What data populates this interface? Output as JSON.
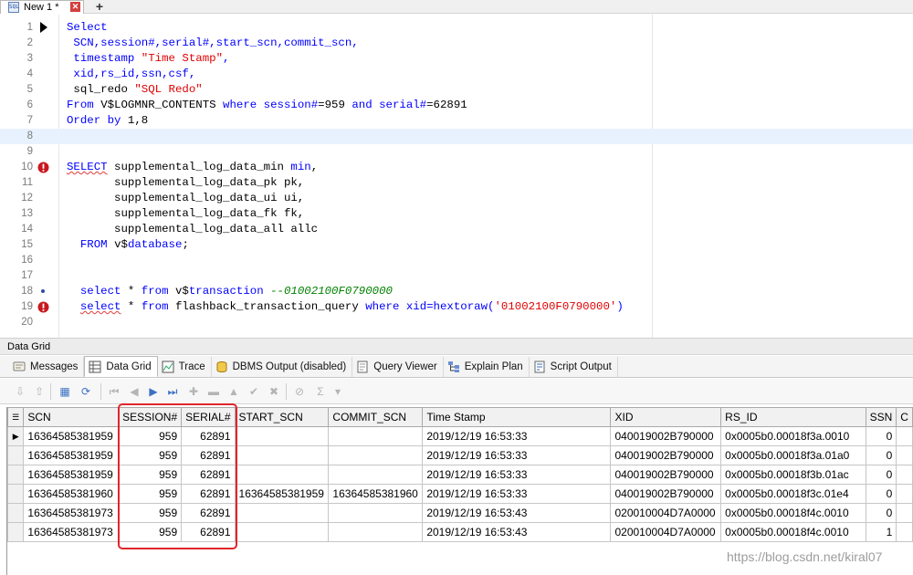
{
  "doc_tab": {
    "icon_text": "SQL",
    "title": "New 1 *",
    "close_label": "✕",
    "new_tab_label": "+"
  },
  "editor": {
    "lines": [
      {
        "n": "1",
        "marker": "current-arrow",
        "parts": [
          {
            "t": "Select",
            "c": "kw"
          }
        ]
      },
      {
        "n": "2",
        "parts": [
          {
            "t": " SCN,session#,serial#,start_scn,commit_scn,",
            "c": "kw"
          }
        ]
      },
      {
        "n": "3",
        "parts": [
          {
            "t": " timestamp ",
            "c": "kw"
          },
          {
            "t": "\"Time Stamp\"",
            "c": "str"
          },
          {
            "t": ",",
            "c": "kw"
          }
        ]
      },
      {
        "n": "4",
        "parts": [
          {
            "t": " xid,rs_id,ssn,csf,",
            "c": "kw"
          }
        ]
      },
      {
        "n": "5",
        "parts": [
          {
            "t": " sql_redo ",
            "c": ""
          },
          {
            "t": "\"SQL Redo\"",
            "c": "str"
          }
        ]
      },
      {
        "n": "6",
        "parts": [
          {
            "t": "From ",
            "c": "kw"
          },
          {
            "t": "V$LOGMNR_CONTENTS ",
            "c": ""
          },
          {
            "t": "where session#",
            "c": "kw"
          },
          {
            "t": "=959 ",
            "c": ""
          },
          {
            "t": "and serial#",
            "c": "kw"
          },
          {
            "t": "=62891",
            "c": ""
          }
        ]
      },
      {
        "n": "7",
        "parts": [
          {
            "t": "Order by ",
            "c": "kw"
          },
          {
            "t": "1,8",
            "c": ""
          }
        ]
      },
      {
        "n": "8",
        "current": true,
        "parts": []
      },
      {
        "n": "9",
        "parts": []
      },
      {
        "n": "10",
        "marker": "error",
        "parts": [
          {
            "t": "SELECT",
            "c": "kw squig"
          },
          {
            "t": " supplemental_log_data_min ",
            "c": ""
          },
          {
            "t": "min",
            "c": "kw"
          },
          {
            "t": ",",
            "c": ""
          }
        ]
      },
      {
        "n": "11",
        "parts": [
          {
            "t": "       supplemental_log_data_pk pk,",
            "c": ""
          }
        ]
      },
      {
        "n": "12",
        "parts": [
          {
            "t": "       supplemental_log_data_ui ui,",
            "c": ""
          }
        ]
      },
      {
        "n": "13",
        "parts": [
          {
            "t": "       supplemental_log_data_fk fk,",
            "c": ""
          }
        ]
      },
      {
        "n": "14",
        "parts": [
          {
            "t": "       supplemental_log_data_all allc",
            "c": ""
          }
        ]
      },
      {
        "n": "15",
        "parts": [
          {
            "t": "  FROM ",
            "c": "kw"
          },
          {
            "t": "v$",
            "c": ""
          },
          {
            "t": "database",
            "c": "kw"
          },
          {
            "t": ";",
            "c": ""
          }
        ]
      },
      {
        "n": "16",
        "parts": []
      },
      {
        "n": "17",
        "parts": []
      },
      {
        "n": "18",
        "marker": "bookmark",
        "parts": [
          {
            "t": "  select ",
            "c": "kw"
          },
          {
            "t": "* ",
            "c": ""
          },
          {
            "t": "from ",
            "c": "kw"
          },
          {
            "t": "v$",
            "c": ""
          },
          {
            "t": "transaction ",
            "c": "kw"
          },
          {
            "t": "--01002100F0790000",
            "c": "cmt"
          }
        ]
      },
      {
        "n": "19",
        "marker": "error",
        "parts": [
          {
            "t": "  ",
            "c": ""
          },
          {
            "t": "select",
            "c": "kw squig"
          },
          {
            "t": " * ",
            "c": ""
          },
          {
            "t": "from ",
            "c": "kw"
          },
          {
            "t": "flashback_transaction_query ",
            "c": ""
          },
          {
            "t": "where xid=hextoraw(",
            "c": "kw"
          },
          {
            "t": "'01002100F0790000'",
            "c": "str"
          },
          {
            "t": ")",
            "c": "kw"
          }
        ]
      },
      {
        "n": "20",
        "parts": []
      }
    ]
  },
  "panel": {
    "title": "Data Grid",
    "tabs": [
      {
        "label": "Messages",
        "icon": "messages-icon",
        "active": false
      },
      {
        "label": "Data Grid",
        "icon": "data-grid-icon",
        "active": true
      },
      {
        "label": "Trace",
        "icon": "trace-icon",
        "active": false
      },
      {
        "label": "DBMS Output (disabled)",
        "icon": "dbms-output-icon",
        "active": false
      },
      {
        "label": "Query Viewer",
        "icon": "query-viewer-icon",
        "active": false
      },
      {
        "label": "Explain Plan",
        "icon": "explain-plan-icon",
        "active": false
      },
      {
        "label": "Script Output",
        "icon": "script-output-icon",
        "active": false
      }
    ]
  },
  "toolbar": {
    "buttons": [
      {
        "name": "export-icon",
        "glyph": "⇩",
        "enabled": false
      },
      {
        "name": "import-icon",
        "glyph": "⇧",
        "enabled": false
      },
      {
        "name": "grid-settings-icon",
        "glyph": "▦",
        "enabled": true
      },
      {
        "name": "refresh-icon",
        "glyph": "⟳",
        "enabled": true
      },
      {
        "name": "first-record-icon",
        "glyph": "⏮",
        "enabled": false
      },
      {
        "name": "prior-record-icon",
        "glyph": "◀",
        "enabled": false
      },
      {
        "name": "next-record-icon",
        "glyph": "▶",
        "enabled": true
      },
      {
        "name": "last-record-icon",
        "glyph": "⏭",
        "enabled": true
      },
      {
        "name": "insert-record-icon",
        "glyph": "✚",
        "enabled": false
      },
      {
        "name": "delete-record-icon",
        "glyph": "▬",
        "enabled": false
      },
      {
        "name": "edit-record-icon",
        "glyph": "▲",
        "enabled": false
      },
      {
        "name": "post-edit-icon",
        "glyph": "✔",
        "enabled": false
      },
      {
        "name": "cancel-edit-icon",
        "glyph": "✖",
        "enabled": false
      },
      {
        "name": "filter-icon",
        "glyph": "⊘",
        "enabled": false
      },
      {
        "name": "sum-icon",
        "glyph": "Σ",
        "enabled": false
      },
      {
        "name": "sum-dropdown-icon",
        "glyph": "▾",
        "enabled": false
      }
    ]
  },
  "grid": {
    "columns": [
      "SCN",
      "SESSION#",
      "SERIAL#",
      "START_SCN",
      "COMMIT_SCN",
      "Time Stamp",
      "XID",
      "RS_ID",
      "SSN",
      "C"
    ],
    "rows": [
      [
        "16364585381959",
        "959",
        "62891",
        "",
        "",
        "2019/12/19 16:53:33",
        "040019002B790000",
        "0x0005b0.00018f3a.0010",
        "0",
        ""
      ],
      [
        "16364585381959",
        "959",
        "62891",
        "",
        "",
        "2019/12/19 16:53:33",
        "040019002B790000",
        "0x0005b0.00018f3a.01a0",
        "0",
        ""
      ],
      [
        "16364585381959",
        "959",
        "62891",
        "",
        "",
        "2019/12/19 16:53:33",
        "040019002B790000",
        "0x0005b0.00018f3b.01ac",
        "0",
        ""
      ],
      [
        "16364585381960",
        "959",
        "62891",
        "16364585381959",
        "16364585381960",
        "2019/12/19 16:53:33",
        "040019002B790000",
        "0x0005b0.00018f3c.01e4",
        "0",
        ""
      ],
      [
        "16364585381973",
        "959",
        "62891",
        "",
        "",
        "2019/12/19 16:53:43",
        "020010004D7A0000",
        "0x0005b0.00018f4c.0010",
        "0",
        ""
      ],
      [
        "16364585381973",
        "959",
        "62891",
        "",
        "",
        "2019/12/19 16:53:43",
        "020010004D7A0000",
        "0x0005b0.00018f4c.0010",
        "1",
        ""
      ]
    ],
    "current_row_indicator": "▶",
    "header_indicator": "☰"
  },
  "watermark": "https://blog.csdn.net/kiral07",
  "colors": {
    "keyword": "#0000ff",
    "string": "#e00000",
    "comment": "#008000",
    "highlight_box": "#e0262b",
    "current_line": "#e8f2fe"
  }
}
